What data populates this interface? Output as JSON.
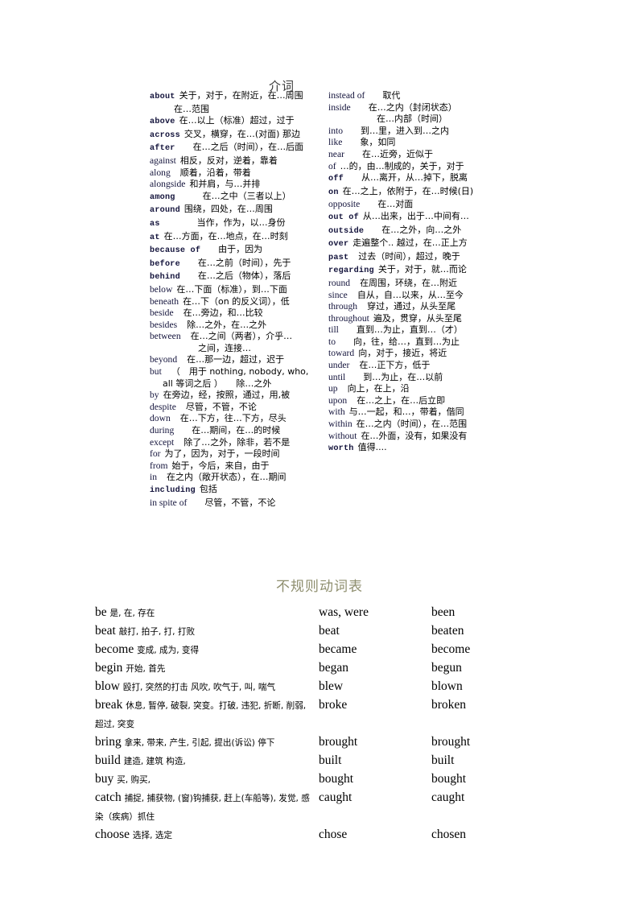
{
  "prepositions": {
    "title": "介词",
    "left_column": [
      {
        "word": "about",
        "style": "b",
        "gap": "sp1",
        "def": "关于，对于，在附近，在…周围"
      },
      {
        "cont": 1,
        "def": "在…范围"
      },
      {
        "word": "above",
        "style": "b",
        "gap": "sp1",
        "def": "在…以上（标准）超过，过于"
      },
      {
        "word": "across",
        "style": "b",
        "gap": "sp1",
        "def": "交叉，横穿，在…(对面) 那边"
      },
      {
        "word": "after",
        "style": "b",
        "gap": "sp3",
        "def": "在…之后（时间），在…后面"
      },
      {
        "word": "against",
        "style": "n",
        "gap": "sp1",
        "def": "相反，反对，逆着，靠着"
      },
      {
        "word": "along",
        "style": "n",
        "gap": "sp2",
        "def": "顺着，沿着，带着"
      },
      {
        "word": "alongside",
        "style": "n",
        "gap": "sp1",
        "def": "和并肩，与…并排"
      },
      {
        "word": "among",
        "style": "b",
        "gap": "sp4",
        "def": "在…之中（三者以上）"
      },
      {
        "word": "around",
        "style": "b",
        "gap": "sp1",
        "def": "围绕，四处，在…周围"
      },
      {
        "word": "as",
        "style": "b",
        "gap": "sp5",
        "def": "当作，作为，以…身份"
      },
      {
        "word": "at",
        "style": "b",
        "gap": "sp1",
        "def": "在…方面，在…地点，在…时刻"
      },
      {
        "word": "because of",
        "style": "bof",
        "gap": "sp3",
        "def": "由于，因为"
      },
      {
        "word": "before",
        "style": "b",
        "gap": "sp3",
        "def": "在…之前（时间），先于"
      },
      {
        "word": "behind",
        "style": "b",
        "gap": "sp3",
        "def": "在…之后（物体），落后"
      },
      {
        "word": "below",
        "style": "n",
        "gap": "sp1",
        "def": "在…下面（标准），到…下面"
      },
      {
        "word": "beneath",
        "style": "n",
        "gap": "sp1",
        "def": "在…下（on 的反义词），低"
      },
      {
        "word": "beside",
        "style": "n",
        "gap": "sp2",
        "def": "在…旁边，和…比较"
      },
      {
        "word": "besides",
        "style": "n",
        "gap": "sp2",
        "def": "除…之外，在…之外"
      },
      {
        "word": "between",
        "style": "n",
        "gap": "sp2",
        "def": "在…之间（两者），介乎…"
      },
      {
        "cont": 2,
        "def": "之间，连接…"
      },
      {
        "word": "beyond",
        "style": "n",
        "gap": "sp2",
        "def": "在…那一边，超过，迟于"
      },
      {
        "word": "but",
        "style": "n",
        "gap": "sp2",
        "def": "（　用于 nothing, nobody, who,"
      },
      {
        "cont": 3,
        "def": "all 等词之后 ）　　除…之外"
      },
      {
        "word": "by",
        "style": "n",
        "gap": "sp1",
        "def": "在旁边，经，按照，通过，用,被"
      },
      {
        "word": "despite",
        "style": "n",
        "gap": "sp2",
        "def": "尽管，不管，不论"
      },
      {
        "word": "down",
        "style": "n",
        "gap": "sp2",
        "def": "在…下方，往…下方，尽头"
      },
      {
        "word": "during",
        "style": "n",
        "gap": "sp3",
        "def": "在…期间，在…的时候"
      },
      {
        "word": "except",
        "style": "n",
        "gap": "sp2",
        "def": "除了…之外，除非，若不是"
      },
      {
        "word": "for",
        "style": "n",
        "gap": "sp1",
        "def": "为了，因为，对于，一段时间"
      },
      {
        "word": "from",
        "style": "n",
        "gap": "sp1",
        "def": "始于，今后，来自，由于"
      },
      {
        "word": "in",
        "style": "n",
        "gap": "sp2",
        "def": "在之内（敞开状态），在…期间"
      },
      {
        "word": "including",
        "style": "b",
        "gap": "sp1",
        "def": "包括"
      },
      {
        "word": "in spite of",
        "style": "n",
        "gap": "sp3",
        "def": "尽管，不管，不论"
      }
    ],
    "right_column": [
      {
        "word": "instead of",
        "style": "n",
        "gap": "sp3",
        "def": "取代"
      },
      {
        "word": "inside",
        "style": "n",
        "gap": "sp3",
        "def": "在…之内（封闭状态）"
      },
      {
        "cont": 2,
        "def": "在…内部（时间）"
      },
      {
        "word": "into",
        "style": "n",
        "gap": "sp3",
        "def": "到…里，进入到…之内"
      },
      {
        "word": "like",
        "style": "n",
        "gap": "sp3",
        "def": "象，如同"
      },
      {
        "word": "near",
        "style": "n",
        "gap": "sp3",
        "def": "在…近旁，近似于"
      },
      {
        "word": "of",
        "style": "n",
        "gap": "sp1",
        "def": "…的，由…制成的，关于，对于"
      },
      {
        "word": "off",
        "style": "b",
        "gap": "sp3",
        "def": "从…离开，从…掉下，脱离"
      },
      {
        "word": "on",
        "style": "b",
        "gap": "sp1",
        "def": "在…之上，依附于，在…时候(日)"
      },
      {
        "word": "opposite",
        "style": "n",
        "gap": "sp3",
        "def": "在…对面"
      },
      {
        "word": "out of",
        "style": "b",
        "gap": "sp1",
        "def": "从…出来，出于…中间有…"
      },
      {
        "word": "outside",
        "style": "b",
        "gap": "sp3",
        "def": "在…之外，向…之外"
      },
      {
        "word": "over",
        "style": "b",
        "gap": "sp1",
        "def": "走遍整个.. 越过，在…正上方"
      },
      {
        "word": "past",
        "style": "b",
        "gap": "sp2",
        "def": "过去（时间），超过，晚于"
      },
      {
        "word": "regarding",
        "style": "b",
        "gap": "sp1",
        "def": "关于，对于，就…而论"
      },
      {
        "word": "round",
        "style": "n",
        "gap": "sp2",
        "def": "在周围，环绕，在…附近"
      },
      {
        "word": "since",
        "style": "n",
        "gap": "sp2",
        "def": "自从，自…以来，从…至今"
      },
      {
        "word": "through",
        "style": "n",
        "gap": "sp2",
        "def": "穿过，通过，从头至尾"
      },
      {
        "word": "throughout",
        "style": "n",
        "gap": "sp1",
        "def": "遍及，贯穿，从头至尾"
      },
      {
        "word": "till",
        "style": "n",
        "gap": "sp3",
        "def": "直到…为止，直到…（才）"
      },
      {
        "word": "to",
        "style": "n",
        "gap": "sp3",
        "def": "向，往，给…，直到…为止"
      },
      {
        "word": "toward",
        "style": "n",
        "gap": "sp1",
        "def": "向，对于，接近，将近"
      },
      {
        "word": "under",
        "style": "n",
        "gap": "sp2",
        "def": "在…正下方，低于"
      },
      {
        "word": "until",
        "style": "n",
        "gap": "sp3",
        "def": "到…为止，在…以前"
      },
      {
        "word": "up",
        "style": "n",
        "gap": "sp2",
        "def": "向上，在上，沿"
      },
      {
        "word": "upon",
        "style": "n",
        "gap": "sp2",
        "def": "在…之上，在…后立即"
      },
      {
        "word": "with",
        "style": "n",
        "gap": "sp1",
        "def": "与…一起，和…，带着，偕同"
      },
      {
        "word": "within",
        "style": "n",
        "gap": "sp1",
        "def": "在…之内（时间），在…范围"
      },
      {
        "word": "without",
        "style": "n",
        "gap": "sp1",
        "def": "在…外面，没有，如果没有"
      },
      {
        "word": "worth",
        "style": "b",
        "gap": "sp1",
        "def": "值得...."
      }
    ]
  },
  "irregular_verbs": {
    "title": "不规则动词表",
    "rows": [
      {
        "base": "be",
        "meaning": "是, 在, 存在",
        "past": "was, were",
        "participle": "been"
      },
      {
        "base": "beat",
        "meaning": "敲打, 拍子, 打, 打败",
        "past": "beat",
        "participle": "beaten"
      },
      {
        "base": "become",
        "meaning": "变成, 成为, 变得",
        "past": "became",
        "participle": "become"
      },
      {
        "base": "begin",
        "meaning": "开始, 首先",
        "past": "began",
        "participle": "begun"
      },
      {
        "base": "blow",
        "meaning": "殴打, 突然的打击 风吹, 吹气于, 叫, 喘气",
        "past": "blew",
        "participle": "blown"
      },
      {
        "base": "break",
        "meaning": "休息, 暂停, 破裂, 突变。打破, 违犯, 折断, 削弱, 超过, 突变",
        "past": "broke",
        "participle": "broken"
      },
      {
        "base": "bring",
        "meaning": "拿来, 带来, 产生, 引起, 提出(诉讼) 停下",
        "past": "brought",
        "participle": "brought"
      },
      {
        "base": "build",
        "meaning": "建造, 建筑 构造,",
        "past": "built",
        "participle": "built"
      },
      {
        "base": "buy",
        "meaning": "买, 购买,",
        "past": "bought",
        "participle": "bought"
      },
      {
        "base": "catch",
        "meaning": "捕捉, 捕获物, (窗)钩捕获, 赶上(车船等), 发觉, 感染（疾病）抓住",
        "past": "caught",
        "participle": "caught"
      },
      {
        "base": "choose",
        "meaning": "选择, 选定",
        "past": "chose",
        "participle": "chosen"
      }
    ]
  }
}
